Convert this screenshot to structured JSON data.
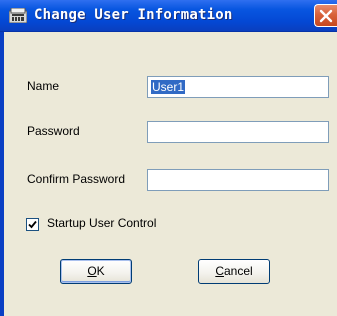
{
  "window": {
    "title": "Change User Information",
    "icon": "app-icon",
    "close_icon": "close-icon"
  },
  "form": {
    "name_label": "Name",
    "name_value": "User1",
    "password_label": "Password",
    "password_value": "",
    "confirm_label": "Confirm Password",
    "confirm_value": ""
  },
  "options": {
    "startup_label": "Startup User Control",
    "startup_checked": true
  },
  "buttons": {
    "ok_mnemonic": "O",
    "ok_rest": "K",
    "cancel_mnemonic": "C",
    "cancel_rest": "ancel"
  },
  "colors": {
    "title_bar": "#0856e0",
    "client_bg": "#ece9d8",
    "selection": "#316ac5",
    "close_button": "#d8623b"
  }
}
